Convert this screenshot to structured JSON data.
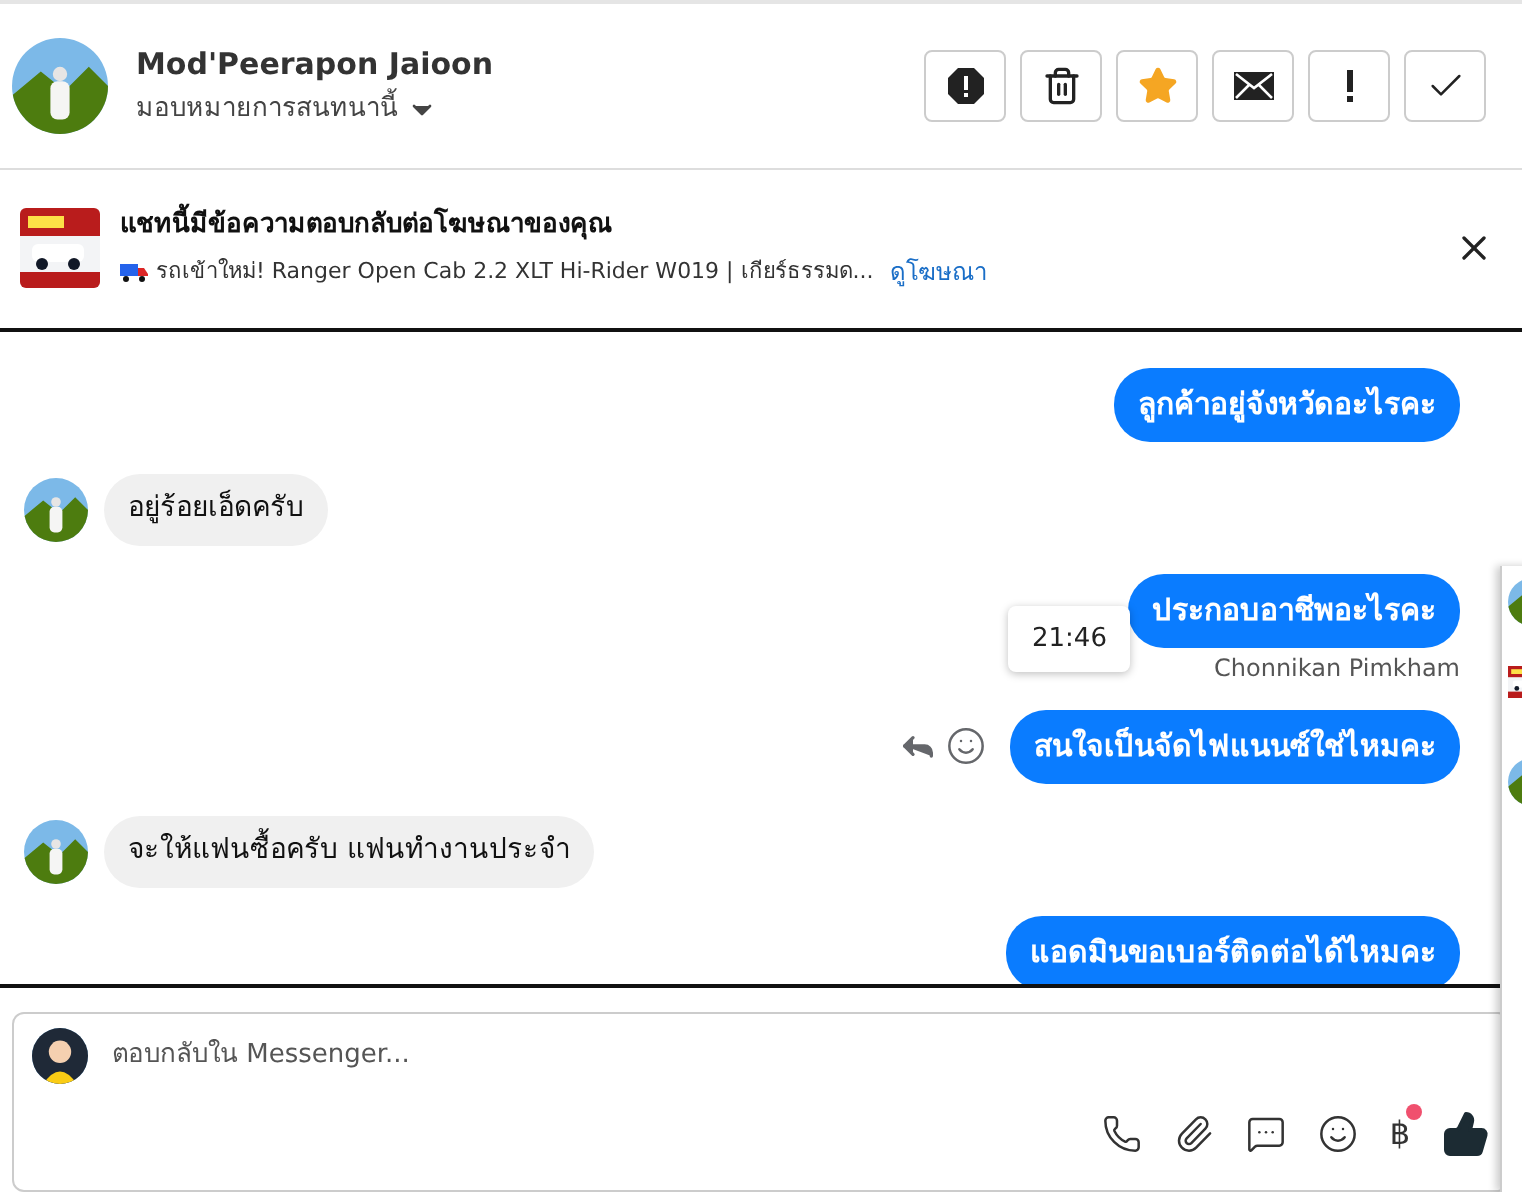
{
  "header": {
    "name": "Mod'Peerapon Jaioon",
    "assign_label": "มอบหมายการสนทนานี้",
    "actions": [
      {
        "kind": "spam"
      },
      {
        "kind": "delete"
      },
      {
        "kind": "star",
        "on": true
      },
      {
        "kind": "unread"
      },
      {
        "kind": "important"
      },
      {
        "kind": "done"
      }
    ]
  },
  "ad_banner": {
    "title": "แชทนี้มีข้อความตอบกลับต่อโฆษณาของคุณ",
    "description": "รถเข้าใหม่! Ranger Open Cab 2.2 XLT Hi-Rider W019 | เกียร์ธรรมด...",
    "link": "ดูโฆษณา"
  },
  "messages": [
    {
      "kind": "outgoing",
      "text": "ลูกค้าอยู่จังหวัดอะไรคะ"
    },
    {
      "kind": "incoming",
      "text": "อยู่ร้อยเอ็ดครับ"
    },
    {
      "kind": "outgoing",
      "text": "ประกอบอาชีพอะไรคะ",
      "time": "21:46",
      "name_after": "Chonnikan Pimkham"
    },
    {
      "kind": "outgoing",
      "text": "สนใจเป็นจัดไฟแนนซ์ใช่ไหมคะ",
      "hover_actions": true
    },
    {
      "kind": "incoming",
      "text": "จะให้แฟนซื้อครับ แฟนทำงานประจำ"
    },
    {
      "kind": "outgoing",
      "text": "แอดมินขอเบอร์ติดต่อได้ไหมคะ"
    }
  ],
  "composer": {
    "placeholder": "ตอบกลับใน Messenger...",
    "payment_symbol": "฿",
    "payment_badge": true
  }
}
